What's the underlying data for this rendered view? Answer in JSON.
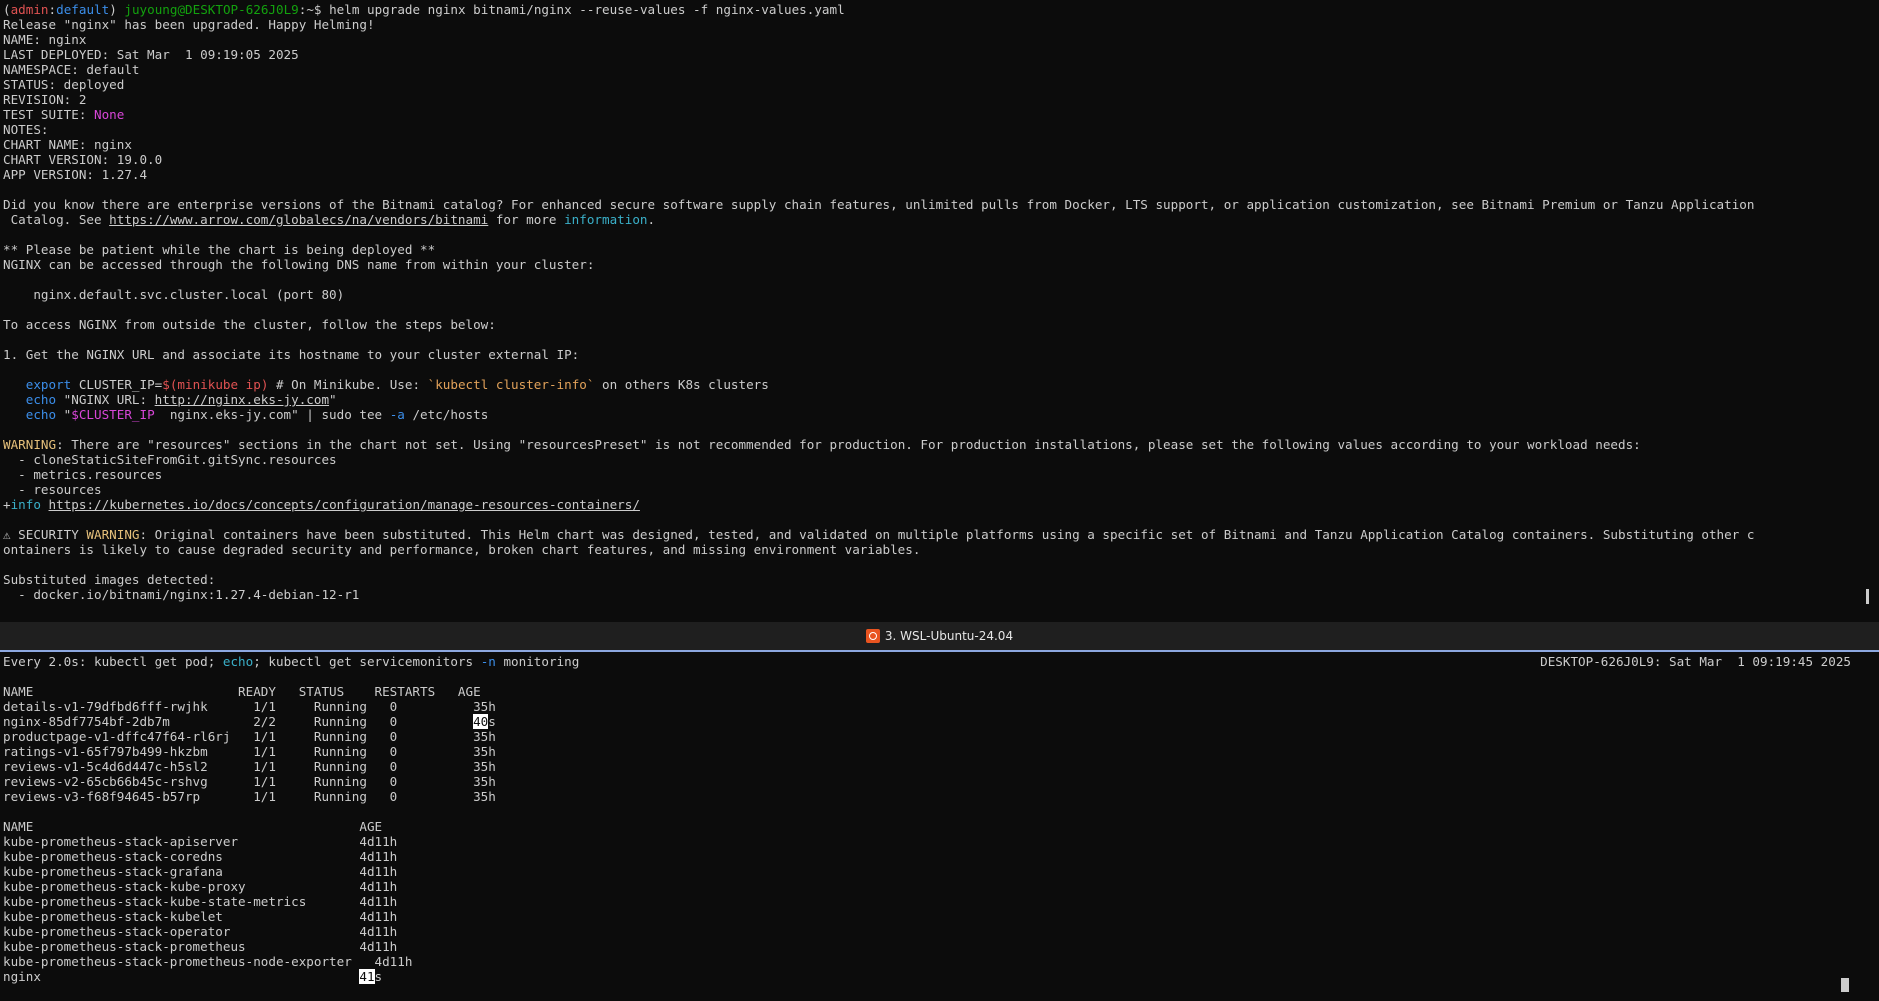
{
  "top": {
    "prompt": {
      "ctx_open": "(",
      "ctx_user": "admin",
      "ctx_sep": ":",
      "ctx_ns": "default",
      "ctx_close": ")",
      "host": "juyoung@DESKTOP-626J0L9",
      "path_sep": ":~$",
      "command": " helm upgrade nginx bitnami/nginx --reuse-values -f nginx-values.yaml"
    },
    "out1": [
      "Release \"nginx\" has been upgraded. Happy Helming!",
      "NAME: nginx",
      "LAST DEPLOYED: Sat Mar  1 09:19:05 2025",
      "NAMESPACE: default",
      "STATUS: deployed",
      "REVISION: 2"
    ],
    "test_suite_label": "TEST SUITE: ",
    "test_suite_value": "None",
    "out2": [
      "NOTES:",
      "CHART NAME: nginx",
      "CHART VERSION: 19.0.0",
      "APP VERSION: 1.27.4",
      ""
    ],
    "did_you_know": "Did you know there are enterprise versions of the Bitnami catalog? For enhanced secure software supply chain features, unlimited pulls from Docker, LTS support, or application customization, see Bitnami Premium or Tanzu Application",
    "catalog_pre": " Catalog. See ",
    "catalog_url": "https://www.arrow.com/globalecs/na/vendors/bitnami",
    "catalog_mid": " for more ",
    "catalog_info": "information",
    "catalog_end": ".",
    "out3": [
      "",
      "** Please be patient while the chart is being deployed **",
      "NGINX can be accessed through the following DNS name from within your cluster:",
      "",
      "    nginx.default.svc.cluster.local (port 80)",
      "",
      "To access NGINX from outside the cluster, follow the steps below:",
      "",
      "1. Get the NGINX URL and associate its hostname to your cluster external IP:",
      ""
    ],
    "export_kw": "   export",
    "export_var": " CLUSTER_IP=",
    "export_sub": "$(minikube ip)",
    "export_comment": " # On Minikube. Use: ",
    "export_cmd": "`kubectl cluster-info`",
    "export_tail": " on others K8s clusters",
    "echo1_kw": "   echo",
    "echo1_text": " \"NGINX URL: ",
    "echo1_url": "http://nginx.eks-jy.com",
    "echo1_end": "\"",
    "echo2_kw": "   echo",
    "echo2_q": " \"",
    "echo2_var": "$CLUSTER_IP",
    "echo2_text": "  nginx.eks-jy.com\" | sudo tee ",
    "echo2_flag": "-a",
    "echo2_end": " /etc/hosts",
    "warn_label": "WARNING",
    "warn_text": ": There are \"resources\" sections in the chart not set. Using \"resourcesPreset\" is not recommended for production. For production installations, please set the following values according to your workload needs:",
    "warn_items": [
      "  - cloneStaticSiteFromGit.gitSync.resources",
      "  - metrics.resources",
      "  - resources"
    ],
    "info_plus": "+",
    "info_label": "info",
    "info_url": "https://kubernetes.io/docs/concepts/configuration/manage-resources-containers/",
    "sec_icon": "⚠ SECURITY ",
    "sec_label": "WARNING",
    "sec_text1": ": Original containers have been substituted. This Helm chart was designed, tested, and validated on multiple platforms using a specific set of Bitnami and Tanzu Application Catalog containers. Substituting other c",
    "sec_text2": "ontainers is likely to cause degraded security and performance, broken chart features, and missing environment variables.",
    "sub_title": "Substituted images detected:",
    "sub_image": "  - docker.io/bitnami/nginx:1.27.4-debian-12-r1"
  },
  "pane_title": "3. WSL-Ubuntu-24.04",
  "bottom": {
    "watch_pre": "Every 2.0s: kubectl get pod; ",
    "watch_echo": "echo",
    "watch_mid": "; kubectl get servicemonitors ",
    "watch_flag": "-n",
    "watch_end": " monitoring",
    "watch_right": "DESKTOP-626J0L9: Sat Mar  1 09:19:45 2025",
    "pod_header": "NAME                           READY   STATUS    RESTARTS   AGE",
    "pods": [
      "details-v1-79dfbd6fff-rwjhk      1/1     Running   0          35h",
      "productpage-v1-dffc47f64-rl6rj   1/1     Running   0          35h",
      "ratings-v1-65f797b499-hkzbm      1/1     Running   0          35h",
      "reviews-v1-5c4d6d447c-h5sl2      1/1     Running   0          35h",
      "reviews-v2-65cb66b45c-rshvg      1/1     Running   0          35h",
      "reviews-v3-f68f94645-b57rp       1/1     Running   0          35h"
    ],
    "nginx_pod_pre": "nginx-85df7754bf-2db7m           2/2     Running   0          ",
    "nginx_pod_hl": "40",
    "nginx_pod_post": "s",
    "sm_header": "NAME                                           AGE",
    "sms": [
      "kube-prometheus-stack-apiserver                4d11h",
      "kube-prometheus-stack-coredns                  4d11h",
      "kube-prometheus-stack-grafana                  4d11h",
      "kube-prometheus-stack-kube-proxy               4d11h",
      "kube-prometheus-stack-kube-state-metrics       4d11h",
      "kube-prometheus-stack-kubelet                  4d11h",
      "kube-prometheus-stack-operator                 4d11h",
      "kube-prometheus-stack-prometheus               4d11h",
      "kube-prometheus-stack-prometheus-node-exporter   4d11h"
    ],
    "nginx_sm_pre": "nginx                                          ",
    "nginx_sm_hl": "41",
    "nginx_sm_post": "s"
  }
}
